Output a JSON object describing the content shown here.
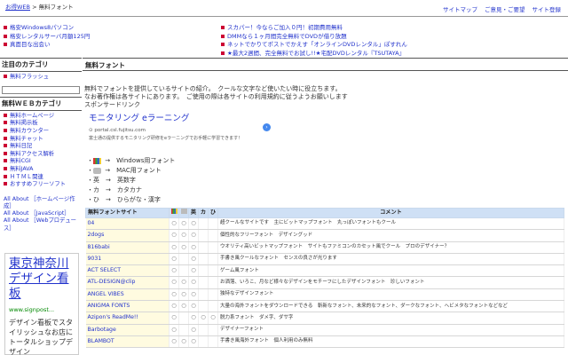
{
  "header": {
    "breadcrumb": [
      "お得WEB",
      ">",
      "無料フォント"
    ],
    "links": [
      "サイトマップ",
      "ご意見・ご要望",
      "サイト登録"
    ]
  },
  "promo_left": [
    "格安Windows8パソコン",
    "格安レンタルサーバ月額125円",
    "真面目な出会い"
  ],
  "promo_right": [
    "スカパー！今ならご加入０円！初期費用無料",
    "DMMなら１ヶ月間完全無料でDVDが借り放題",
    "ネットでかりてポストでかえす「オンラインDVDレンタル」ぽすれん",
    "★最大2週間、完全無料でお試し!!★宅配DVDレンタル『TSUTAYA』"
  ],
  "sidebar": {
    "heading1": "注目のカテゴリ",
    "featured": [
      "無料フラッシュ"
    ],
    "heading2": "無料ＷＥＢカテゴリ",
    "items": [
      "無料ホームページ",
      "無料掲示板",
      "無料カウンター",
      "無料チャット",
      "無料日記",
      "無料アクセス解析",
      "無料CGI",
      "無料JAVA",
      "ＨＴＭＬ関連",
      "おすすめフリーソフト"
    ],
    "about": [
      "All About ［ホームページ作成］",
      "All About ［JavaScript］",
      "All About ［Webプロデュース］"
    ],
    "ad": {
      "title": "東京神奈川デザイン看板",
      "url": "www.signpost...",
      "desc": "デザイン看板でスタイリッシュなお店に トータルショップデザイン"
    }
  },
  "main": {
    "title": "無料フォント",
    "intro": [
      "無料でフォントを提供しているサイトの紹介。　クールな文字など使いたい時に役立ちます。",
      "なお著作権は各サイトにあります。　ご使用の際は各サイトの利用規約に従うようお願いします",
      "スポンサードリンク"
    ],
    "ad": {
      "title": "モニタリング eラーニング",
      "url": "portal.csl.fujitsu.com",
      "desc": "富士通の提供するモニタリング研修をeラーニングでお手軽に学習できます！",
      "arrow": "›"
    },
    "legend": [
      {
        "symbol": "・",
        "arrow": "→",
        "label": "Windows用フォント",
        "icon": "windows-icon"
      },
      {
        "symbol": "・",
        "arrow": "→",
        "label": "MAC用フォント",
        "icon": "mac-icon"
      },
      {
        "symbol": "・英",
        "arrow": "→",
        "label": "英数字"
      },
      {
        "symbol": "・カ",
        "arrow": "→",
        "label": "カタカナ"
      },
      {
        "symbol": "・ひ",
        "arrow": "→",
        "label": "ひらがな・漢字"
      }
    ],
    "table": {
      "headers": [
        "無料フォントサイト",
        "",
        "",
        "英",
        "カ",
        "ひ",
        "コメント"
      ],
      "rows": [
        {
          "site": "04",
          "w": "○",
          "m": "○",
          "e": "○",
          "k": "",
          "h": "",
          "comment": "超クールなサイトです　主にビットマップフォント　丸っぽいフォントもクール"
        },
        {
          "site": "2dogs",
          "w": "○",
          "m": "○",
          "e": "○",
          "k": "",
          "h": "",
          "comment": "個性的なフリーフォント　デザイングッド"
        },
        {
          "site": "816babi",
          "w": "○",
          "m": "○",
          "e": "○",
          "k": "",
          "h": "",
          "comment": "ウオリティ高いビットマップフォント　サイトもファミコンのカセット風でクール　プロのデザイナー？"
        },
        {
          "site": "9031",
          "w": "○",
          "m": "",
          "e": "○",
          "k": "",
          "h": "",
          "comment": "手書き風クールなフォント　センスの良さが光ります"
        },
        {
          "site": "ACT SELECT",
          "w": "○",
          "m": "",
          "e": "○",
          "k": "",
          "h": "",
          "comment": "ゲーム風フォント"
        },
        {
          "site": "ATL-DESIGN@clip",
          "w": "○",
          "m": "○",
          "e": "○",
          "k": "",
          "h": "",
          "comment": "お洒落、いろこ、月など様々なデザインをモチーフにしたデザインフォント　珍しいフォント"
        },
        {
          "site": "ANGEL VIBES",
          "w": "○",
          "m": "○",
          "e": "○",
          "k": "",
          "h": "",
          "comment": "独特なデザインフォント"
        },
        {
          "site": "ANIGMA FONTS",
          "w": "○",
          "m": "○",
          "e": "○",
          "k": "",
          "h": "",
          "comment": "大量の海外フォントをダウンロードできる　斬新なフォント、未来的なフォント、ダークなフォント、ヘビメタなフォントなどなど"
        },
        {
          "site": "Azipon's ReadMe!!",
          "w": "○",
          "m": "",
          "e": "○",
          "k": "○",
          "h": "○",
          "comment": "脱力系フォント　ダメ字、ダサ字"
        },
        {
          "site": "Barbotage",
          "w": "○",
          "m": "",
          "e": "○",
          "k": "",
          "h": "",
          "comment": "デザイナーフォント"
        },
        {
          "site": "BLAMBOT",
          "w": "○",
          "m": "○",
          "e": "○",
          "k": "",
          "h": "",
          "comment": "手書き風海外フォント　個人利用のみ無料"
        }
      ]
    }
  }
}
